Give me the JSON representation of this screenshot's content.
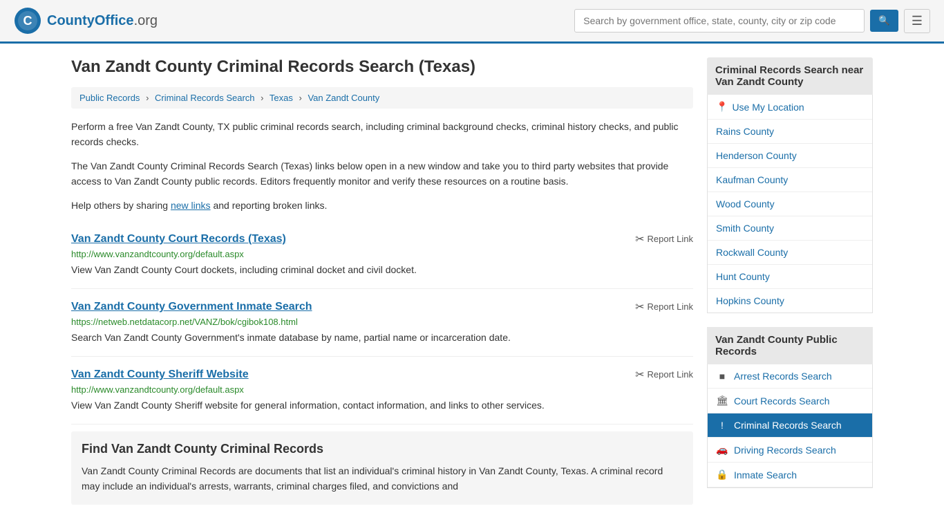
{
  "header": {
    "logo_name": "CountyOffice",
    "logo_suffix": ".org",
    "search_placeholder": "Search by government office, state, county, city or zip code",
    "search_value": ""
  },
  "page": {
    "title": "Van Zandt County Criminal Records Search (Texas)",
    "breadcrumb": [
      {
        "label": "Public Records",
        "href": "#"
      },
      {
        "label": "Criminal Records Search",
        "href": "#"
      },
      {
        "label": "Texas",
        "href": "#"
      },
      {
        "label": "Van Zandt County",
        "href": "#"
      }
    ],
    "description1": "Perform a free Van Zandt County, TX public criminal records search, including criminal background checks, criminal history checks, and public records checks.",
    "description2": "The Van Zandt County Criminal Records Search (Texas) links below open in a new window and take you to third party websites that provide access to Van Zandt County public records. Editors frequently monitor and verify these resources on a routine basis.",
    "description3_pre": "Help others by sharing ",
    "description3_link": "new links",
    "description3_post": " and reporting broken links.",
    "results": [
      {
        "title": "Van Zandt County Court Records (Texas)",
        "url": "http://www.vanzandtcounty.org/default.aspx",
        "description": "View Van Zandt County Court dockets, including criminal docket and civil docket.",
        "report_label": "Report Link"
      },
      {
        "title": "Van Zandt County Government Inmate Search",
        "url": "https://netweb.netdatacorp.net/VANZ/bok/cgibok108.html",
        "description": "Search Van Zandt County Government's inmate database by name, partial name or incarceration date.",
        "report_label": "Report Link"
      },
      {
        "title": "Van Zandt County Sheriff Website",
        "url": "http://www.vanzandtcounty.org/default.aspx",
        "description": "View Van Zandt County Sheriff website for general information, contact information, and links to other services.",
        "report_label": "Report Link"
      }
    ],
    "find_section": {
      "title": "Find Van Zandt County Criminal Records",
      "text": "Van Zandt County Criminal Records are documents that list an individual's criminal history in Van Zandt County, Texas. A criminal record may include an individual's arrests, warrants, criminal charges filed, and convictions and"
    }
  },
  "sidebar": {
    "nearby_header": "Criminal Records Search near Van Zandt County",
    "use_location_label": "Use My Location",
    "nearby_counties": [
      "Rains County",
      "Henderson County",
      "Kaufman County",
      "Wood County",
      "Smith County",
      "Rockwall County",
      "Hunt County",
      "Hopkins County"
    ],
    "public_records_header": "Van Zandt County Public Records",
    "public_records": [
      {
        "label": "Arrest Records Search",
        "icon": "■",
        "active": false
      },
      {
        "label": "Court Records Search",
        "icon": "🏛",
        "active": false
      },
      {
        "label": "Criminal Records Search",
        "icon": "!",
        "active": true
      },
      {
        "label": "Driving Records Search",
        "icon": "🚗",
        "active": false
      },
      {
        "label": "Inmate Search",
        "icon": "🔒",
        "active": false
      }
    ]
  }
}
